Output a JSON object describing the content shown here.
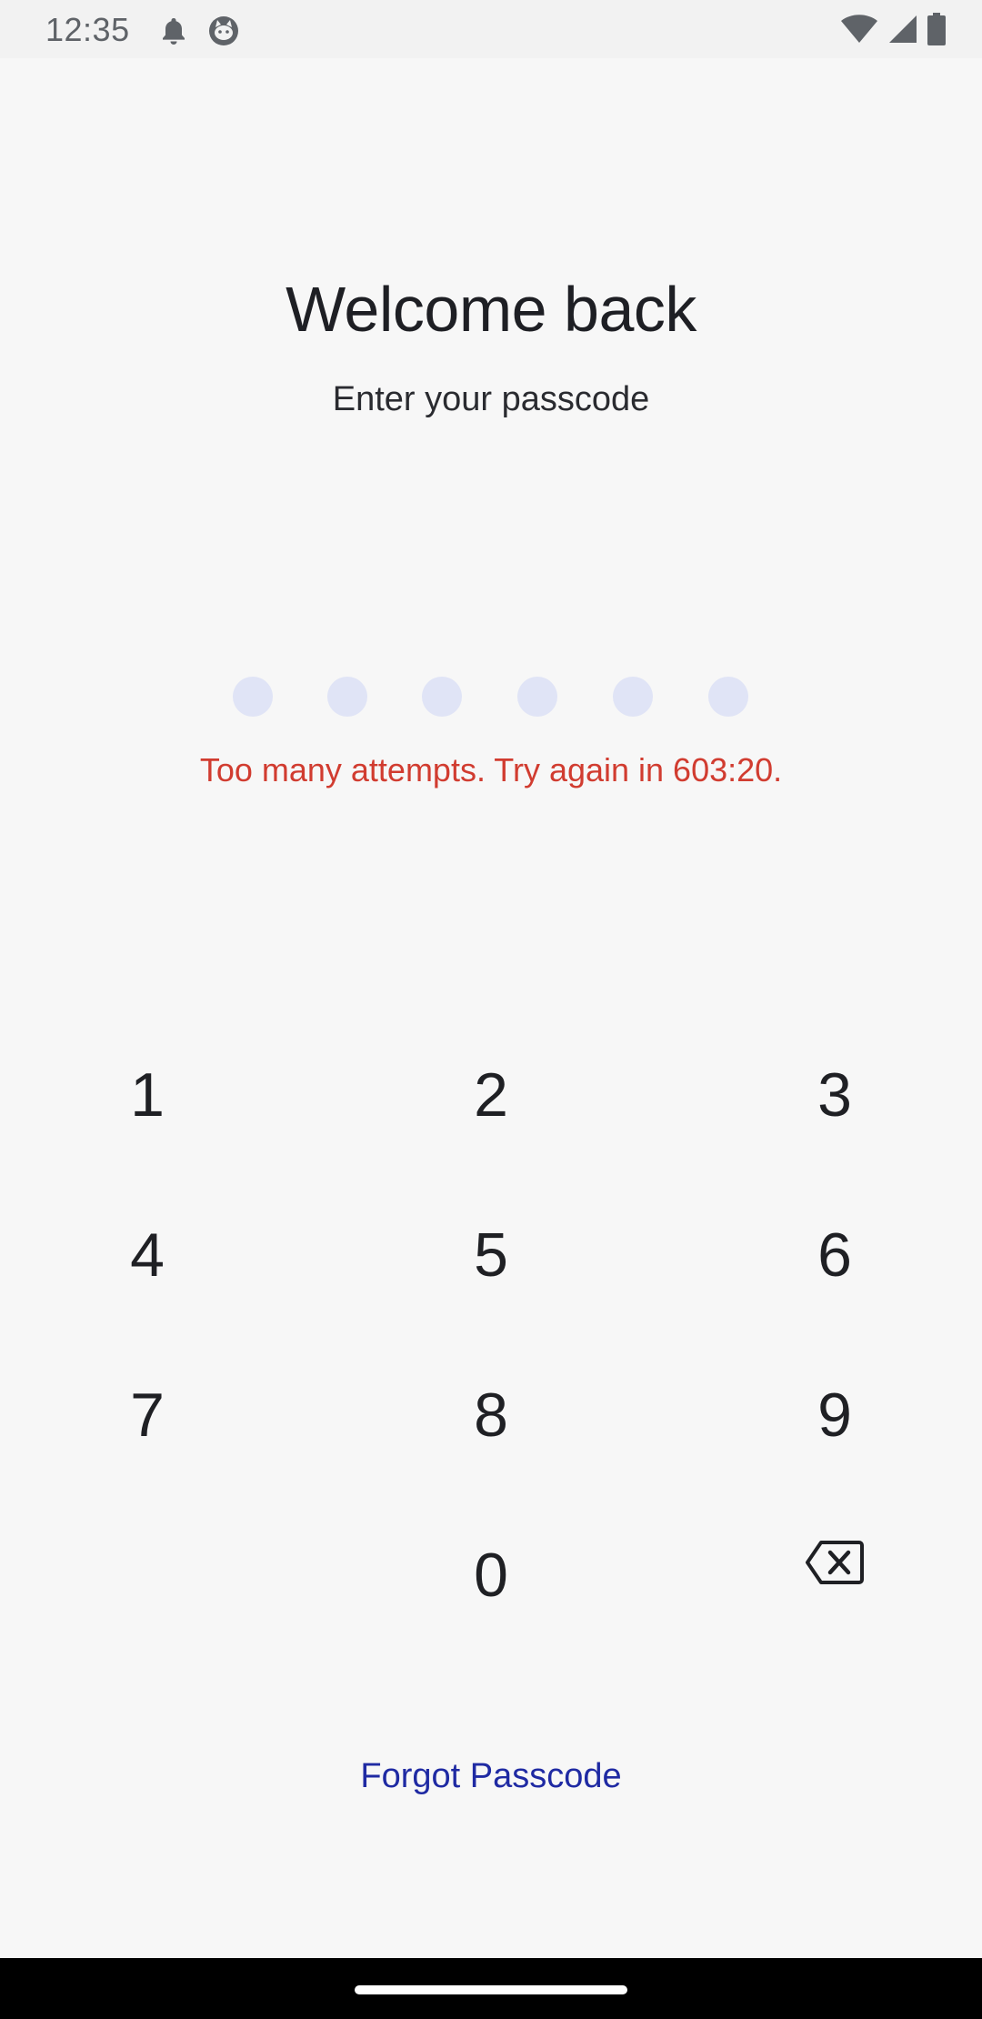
{
  "status_bar": {
    "time": "12:35",
    "left_icons": [
      "bell-icon",
      "cat-face-icon"
    ],
    "right_icons": [
      "wifi-icon",
      "signal-icon",
      "battery-icon"
    ]
  },
  "lock_screen": {
    "title": "Welcome back",
    "subtitle": "Enter your passcode",
    "passcode_length": 6,
    "entered_digits": 0,
    "error_message": "Too many attempts. Try again in 603:20.",
    "error_color": "#d13c30",
    "dot_color": "#e0e4f6"
  },
  "keypad": {
    "keys": [
      "1",
      "2",
      "3",
      "4",
      "5",
      "6",
      "7",
      "8",
      "9",
      "",
      "0",
      "backspace-icon"
    ]
  },
  "forgot_link": {
    "label": "Forgot Passcode",
    "color": "#1f2aa3"
  }
}
